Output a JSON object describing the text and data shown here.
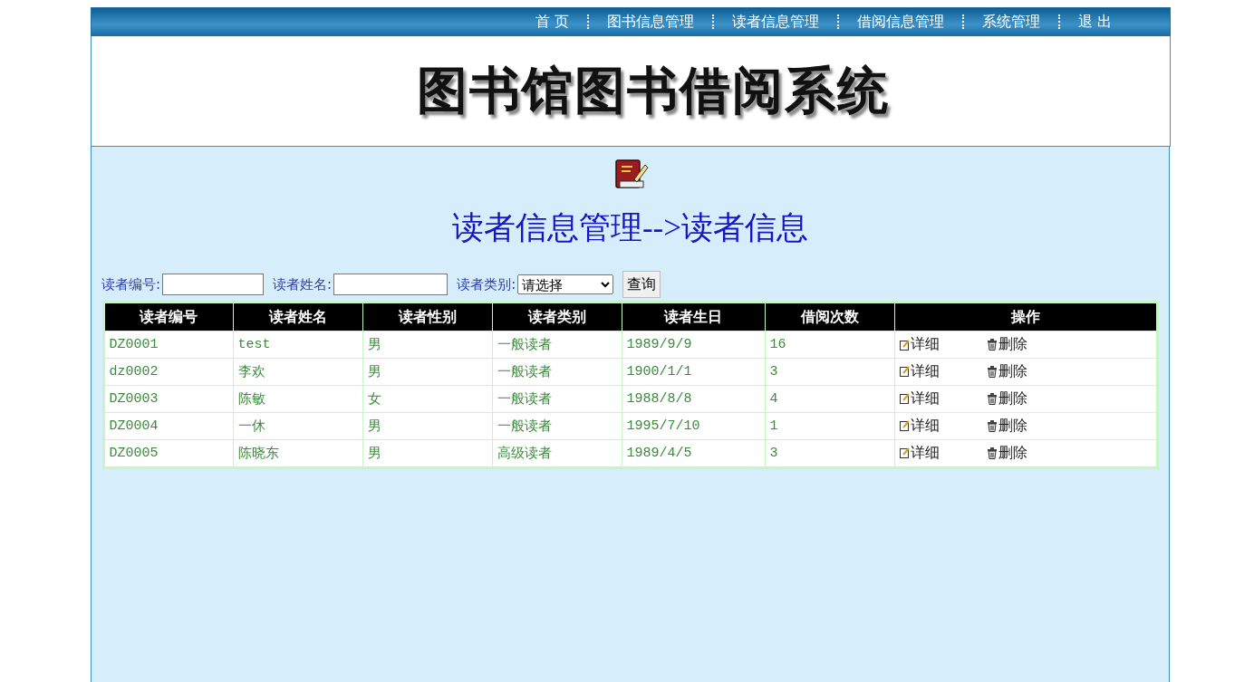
{
  "nav": [
    {
      "label": "首 页"
    },
    {
      "label": "图书信息管理"
    },
    {
      "label": "读者信息管理"
    },
    {
      "label": "借阅信息管理"
    },
    {
      "label": "系统管理"
    },
    {
      "label": "退 出"
    }
  ],
  "banner_title": "图书馆图书借阅系统",
  "heading": "读者信息管理-->读者信息",
  "search": {
    "fields": [
      {
        "label": "读者编号:",
        "kind": "text"
      },
      {
        "label": "读者姓名:",
        "kind": "text"
      },
      {
        "label": "读者类别:",
        "kind": "select",
        "value": "请选择"
      }
    ],
    "button": "查询"
  },
  "table": {
    "columns": [
      "读者编号",
      "读者姓名",
      "读者性别",
      "读者类别",
      "读者生日",
      "借阅次数",
      "操作"
    ],
    "rows": [
      {
        "cells": [
          "DZ0001",
          "test",
          "男",
          "一般读者",
          "1989/9/9",
          "16"
        ],
        "actions": [
          {
            "label": "详细",
            "kind": "edit"
          },
          {
            "label": "删除",
            "kind": "delete"
          }
        ]
      },
      {
        "cells": [
          "dz0002",
          "李欢",
          "男",
          "一般读者",
          "1900/1/1",
          "3"
        ],
        "actions": [
          {
            "label": "详细",
            "kind": "edit"
          },
          {
            "label": "删除",
            "kind": "delete"
          }
        ]
      },
      {
        "cells": [
          "DZ0003",
          "陈敏",
          "女",
          "一般读者",
          "1988/8/8",
          "4"
        ],
        "actions": [
          {
            "label": "详细",
            "kind": "edit"
          },
          {
            "label": "删除",
            "kind": "delete"
          }
        ]
      },
      {
        "cells": [
          "DZ0004",
          "一休",
          "男",
          "一般读者",
          "1995/7/10",
          "1"
        ],
        "actions": [
          {
            "label": "详细",
            "kind": "edit"
          },
          {
            "label": "删除",
            "kind": "delete"
          }
        ]
      },
      {
        "cells": [
          "DZ0005",
          "陈晓东",
          "男",
          "高级读者",
          "1989/4/5",
          "3"
        ],
        "actions": [
          {
            "label": "详细",
            "kind": "edit"
          },
          {
            "label": "删除",
            "kind": "delete"
          }
        ]
      }
    ]
  }
}
